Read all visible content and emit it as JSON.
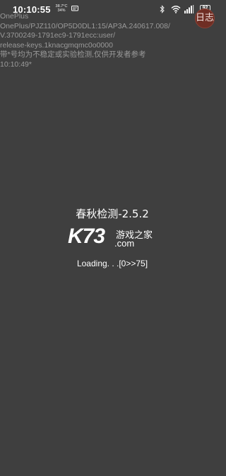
{
  "status_bar": {
    "time": "10:10:55",
    "temperature": "38.7°C",
    "battery_percent_small": "34%",
    "battery_level": "92",
    "icons": [
      "message-icon",
      "bluetooth-icon",
      "wifi-icon",
      "signal-icon",
      "battery-icon"
    ]
  },
  "float_bubble": {
    "label": "日志"
  },
  "device_info": {
    "lines": [
      "OnePlus",
      "OnePlus/PJZ110/OP5D0DL1:15/AP3A.240617.008/",
      "V.3700249-1791ec9-1791ecc:user/",
      "release-keys.1knacgmqmc0o0000",
      "带*号均为不稳定或实验检测,仅供开发者参考",
      "10:10:49*"
    ]
  },
  "main": {
    "title": "春秋检测-2.5.2",
    "watermark_brand": "K73",
    "watermark_site": "游戏之家",
    "watermark_domain": ".com",
    "loading": "Loading. . .[0>>75]"
  },
  "colors": {
    "background": "#3f3f3f",
    "text_primary": "#ffffff",
    "text_overlay": "#9a9a9a",
    "bubble": "#6f2e24"
  }
}
